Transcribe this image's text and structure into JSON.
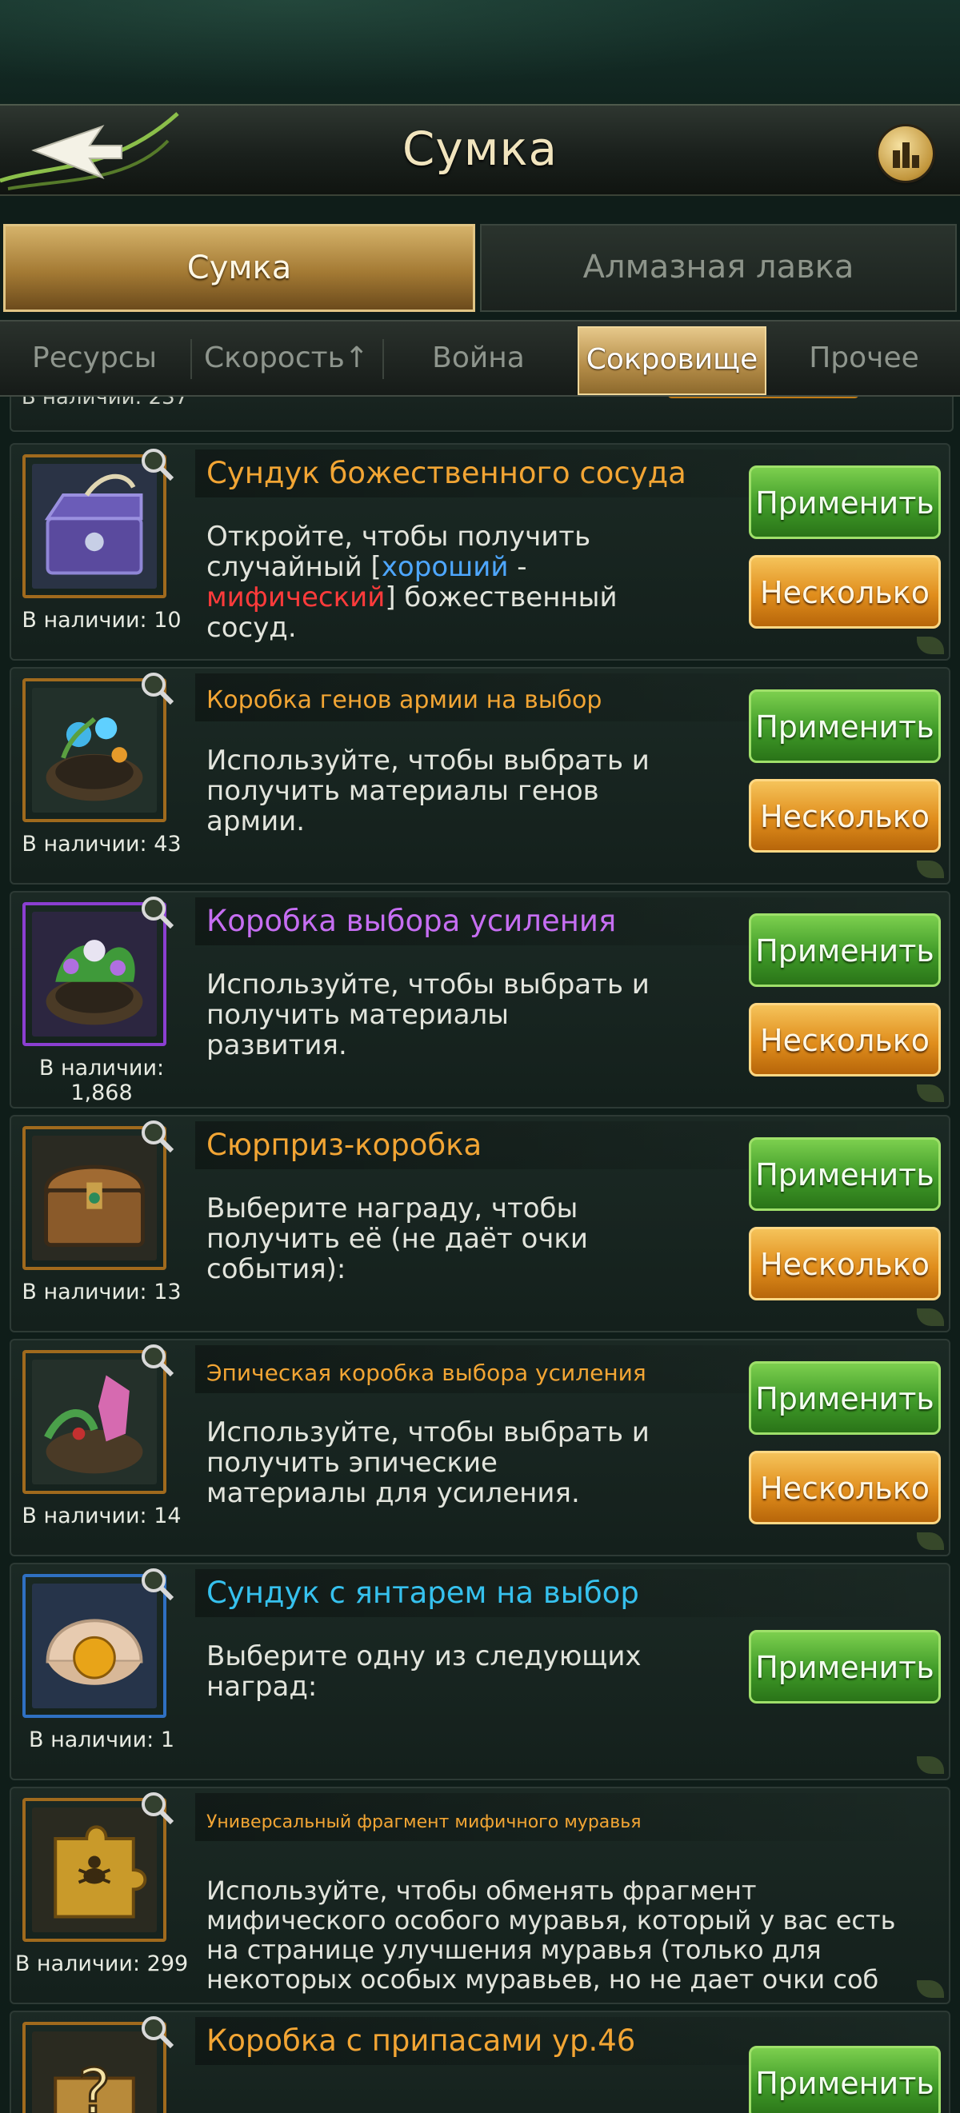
{
  "header": {
    "title": "Сумка"
  },
  "main_tabs": [
    {
      "label": "Сумка",
      "active": true
    },
    {
      "label": "Алмазная лавка",
      "active": false
    }
  ],
  "sub_tabs": [
    {
      "label": "Ресурсы",
      "active": false
    },
    {
      "label": "Скорость↑",
      "active": false
    },
    {
      "label": "Война",
      "active": false
    },
    {
      "label": "Сокровище",
      "active": true
    },
    {
      "label": "Прочее",
      "active": false
    }
  ],
  "buttons": {
    "apply": "Применить",
    "multiple": "Несколько"
  },
  "partial_top_item": {
    "stock": "В наличии: 237"
  },
  "items": [
    {
      "title": "Сундук божественного сосуда",
      "desc_a": "Откройте, чтобы получить случайный [",
      "desc_good": "хороший",
      "desc_b": " -",
      "desc_myth": "мифический",
      "desc_c": "] божественный сосуд.",
      "stock": "В наличии: 10",
      "frame": "orange",
      "icon": "divine-vessel-chest-icon"
    },
    {
      "title": "Коробка генов армии на выбор",
      "desc": "Используйте, чтобы выбрать и получить материалы генов армии.",
      "stock": "В наличии: 43",
      "frame": "orange",
      "icon": "army-gene-box-icon"
    },
    {
      "title": "Коробка выбора усиления",
      "desc": "Используйте, чтобы выбрать и получить материалы развития.",
      "stock": "В наличии: 1,868",
      "frame": "purple",
      "icon": "enhancement-box-icon"
    },
    {
      "title": "Сюрприз-коробка",
      "desc": "Выберите награду, чтобы получить её (не даёт очки события):",
      "stock": "В наличии: 13",
      "frame": "orange",
      "icon": "surprise-chest-icon"
    },
    {
      "title": "Эпическая коробка выбора усиления",
      "desc": "Используйте, чтобы выбрать и получить эпические материалы для усиления.",
      "stock": "В наличии: 14",
      "frame": "orange",
      "icon": "epic-enhancement-box-icon"
    },
    {
      "title": "Сундук с янтарем на выбор",
      "desc": "Выберите одну из следующих наград:",
      "stock": "В наличии: 1",
      "frame": "blue",
      "icon": "amber-shell-icon"
    },
    {
      "title": "Универсальный фрагмент мифичного муравья",
      "desc": "Используйте, чтобы обменять фрагмент мифического особого муравья, который у вас есть на странице улучшения муравья (только для некоторых особых муравьев, но не дает очки соб",
      "stock": "В наличии: 299",
      "frame": "orange",
      "icon": "mythic-ant-fragment-icon"
    },
    {
      "title": "Коробка с припасами ур.46",
      "stock": "",
      "frame": "orange",
      "icon": "supply-box-icon"
    }
  ]
}
